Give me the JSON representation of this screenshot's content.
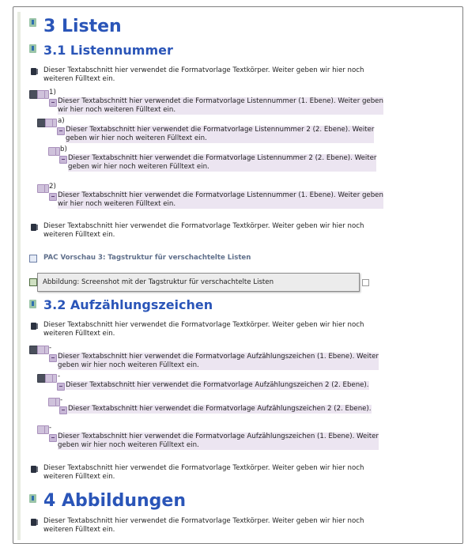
{
  "headings": {
    "h3": "3 Listen",
    "h31": "3.1 Listennummer",
    "h32": "3.2 Aufzählungszeichen",
    "h4": "4 Abbildungen"
  },
  "body_text": {
    "line1": "Dieser Textabschnitt hier verwendet die Formatvorlage Textkörper. Weiter geben wir hier noch",
    "line2": "weiteren Fülltext ein."
  },
  "numbered": {
    "item1_marker": "1)",
    "item1_line1": "Dieser Textabschnitt hier verwendet die Formatvorlage Listennummer (1. Ebene). Weiter geben",
    "item1_line2": "wir hier noch weiteren Fülltext ein.",
    "sub_a_marker": "a)",
    "sub_a_line1": "Dieser Textabschnitt hier verwendet die Formatvorlage Listennummer 2 (2. Ebene). Weiter",
    "sub_a_line2": "geben wir hier noch weiteren Fülltext ein.",
    "sub_b_marker": "b)",
    "sub_b_line1": "Dieser Textabschnitt hier verwendet die Formatvorlage Listennummer 2 (2. Ebene). Weiter",
    "sub_b_line2": "geben wir hier noch weiteren Fülltext ein.",
    "item2_marker": "2)",
    "item2_line1": "Dieser Textabschnitt hier verwendet die Formatvorlage Listennummer (1. Ebene). Weiter geben",
    "item2_line2": "wir hier noch weiteren Fülltext ein."
  },
  "pac_preview": "PAC Vorschau 3: Tagstruktur für verschachtelte Listen",
  "figure_tooltip": "Abbildung: Screenshot mit der Tagstruktur für verschachtelte Listen",
  "bullets": {
    "marker": "-",
    "item1_line1": "Dieser Textabschnitt hier verwendet die Formatvorlage Aufzählungszeichen (1. Ebene). Weiter",
    "item1_line2": "geben wir hier noch weiteren Fülltext ein.",
    "sub1": "Dieser Textabschnitt hier verwendet die Formatvorlage Aufzählungszeichen 2 (2. Ebene).",
    "sub2": "Dieser Textabschnitt hier verwendet die Formatvorlage Aufzählungszeichen 2 (2. Ebene).",
    "item2_line1": "Dieser Textabschnitt hier verwendet die Formatvorlage Aufzählungszeichen (1. Ebene). Weiter",
    "item2_line2": "geben wir hier noch weiteren Fülltext ein."
  }
}
